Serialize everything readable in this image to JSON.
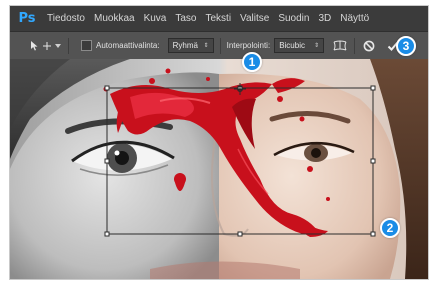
{
  "app": {
    "logo": "Ps"
  },
  "menu": [
    "Tiedosto",
    "Muokkaa",
    "Kuva",
    "Taso",
    "Teksti",
    "Valitse",
    "Suodin",
    "3D",
    "Näyttö"
  ],
  "options": {
    "auto_select_label": "Automaattivalinta:",
    "group_value": "Ryhmä",
    "interpolation_label": "Interpolointi:",
    "interpolation_value": "Bicubic"
  },
  "callouts": [
    "1",
    "2",
    "3"
  ],
  "colors": {
    "accent": "#1a8ce6",
    "splash": "#c8101c",
    "toolbar": "#535353",
    "menubar": "#3b3b3b"
  },
  "icons": [
    "move-tool-icon",
    "chevron-down-icon",
    "warp-icon",
    "cancel-icon",
    "commit-check-icon"
  ]
}
